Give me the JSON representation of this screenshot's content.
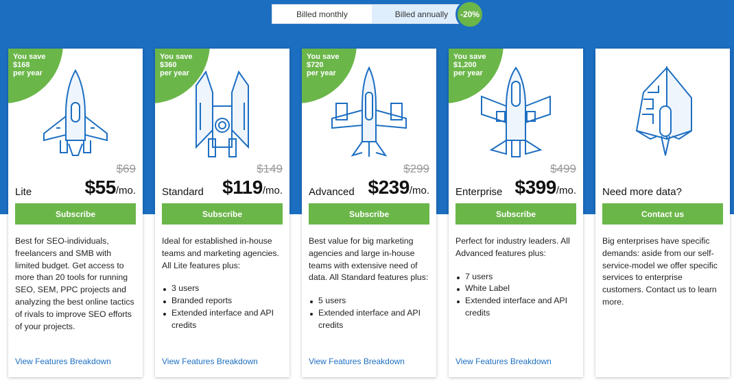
{
  "billing": {
    "monthly_label": "Billed monthly",
    "annual_label": "Billed annually",
    "discount": "-20%"
  },
  "colors": {
    "brand_blue": "#1c6ec1",
    "accent_green": "#6bb649"
  },
  "plans": [
    {
      "save_line1": "You save",
      "save_line2": "$168",
      "save_line3": "per year",
      "old_price": "$69",
      "name": "Lite",
      "price": "$55",
      "per": "/mo.",
      "cta": "Subscribe",
      "desc": "Best for SEO-individuals, freelancers and SMB with limited budget. Get access to more than 20 tools for running SEO, SEM, PPC projects and analyzing the best online tactics of rivals to improve SEO efforts of your projects.",
      "features": [],
      "link": "View Features Breakdown",
      "icon": "rocket-ship-lite-icon"
    },
    {
      "save_line1": "You save",
      "save_line2": "$360",
      "save_line3": "per year",
      "old_price": "$149",
      "name": "Standard",
      "price": "$119",
      "per": "/mo.",
      "cta": "Subscribe",
      "desc": "Ideal for established in-house teams and marketing agencies. All Lite features plus:",
      "features": [
        "3 users",
        "Branded reports",
        "Extended interface and API credits"
      ],
      "link": "View Features Breakdown",
      "icon": "rocket-ship-standard-icon"
    },
    {
      "save_line1": "You save",
      "save_line2": "$720",
      "save_line3": "per year",
      "old_price": "$299",
      "name": "Advanced",
      "price": "$239",
      "per": "/mo.",
      "cta": "Subscribe",
      "desc": "Best value for big marketing agencies and large in-house teams with extensive need of data. All Standard features plus:",
      "features": [
        "5 users",
        "Extended interface and API credits"
      ],
      "link": "View Features Breakdown",
      "icon": "rocket-ship-advanced-icon"
    },
    {
      "save_line1": "You save",
      "save_line2": "$1,200",
      "save_line3": "per year",
      "old_price": "$499",
      "name": "Enterprise",
      "price": "$399",
      "per": "/mo.",
      "cta": "Subscribe",
      "desc": "Perfect for industry leaders. All Advanced features plus:",
      "features": [
        "7 users",
        "White Label",
        "Extended interface and API credits"
      ],
      "link": "View Features Breakdown",
      "icon": "rocket-ship-enterprise-icon"
    }
  ],
  "custom": {
    "name": "Need more data?",
    "cta": "Contact us",
    "desc": "Big enterprises have specific demands: aside from our self-service-model we offer specific services to enterprise customers. Contact us to learn more.",
    "icon": "rocket-ship-custom-icon"
  }
}
